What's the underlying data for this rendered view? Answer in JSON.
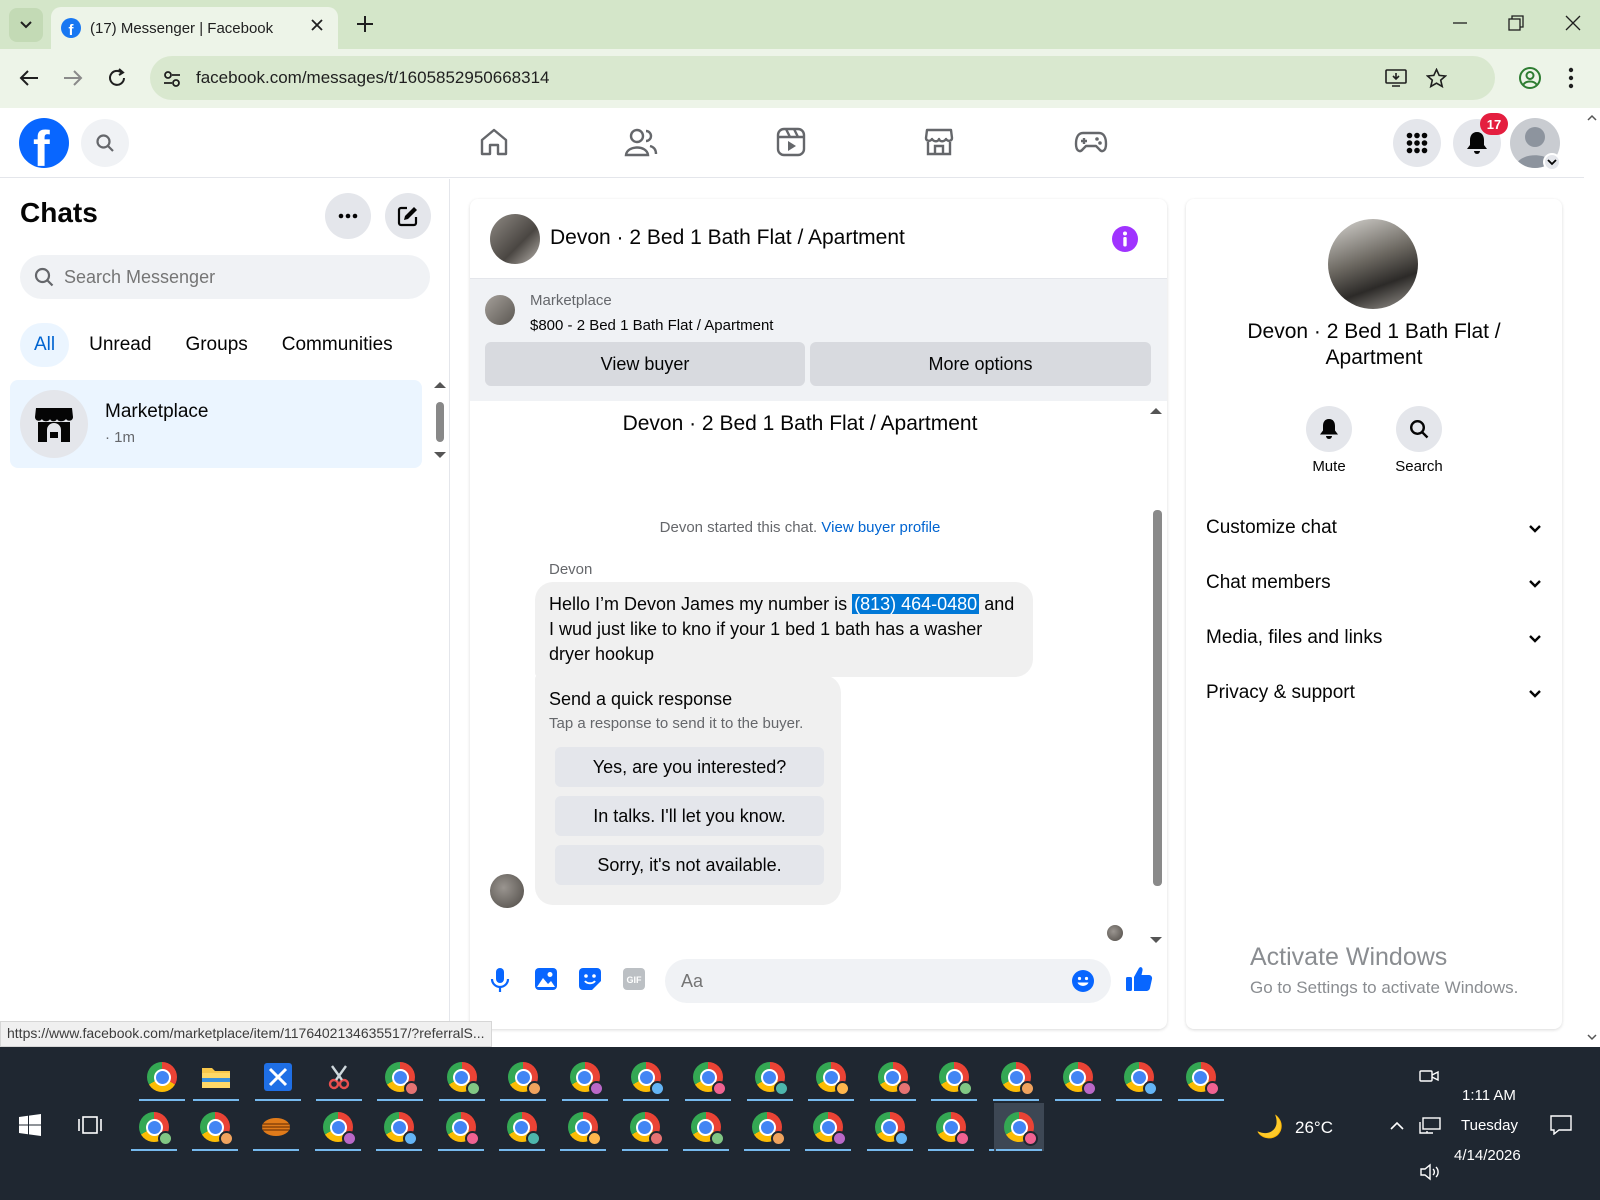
{
  "browser": {
    "tab_title": "(17) Messenger | Facebook",
    "url": "facebook.com/messages/t/1605852950668314"
  },
  "facebook": {
    "notification_count": "17"
  },
  "sidebar": {
    "title": "Chats",
    "search_placeholder": "Search Messenger",
    "filters": [
      "All",
      "Unread",
      "Groups",
      "Communities"
    ],
    "active_filter": "All",
    "chats": [
      {
        "name": "Marketplace",
        "time": "· 1m"
      }
    ]
  },
  "conversation": {
    "title": "Devon · 2 Bed 1 Bath Flat / Apartment",
    "banner": {
      "label": "Marketplace",
      "listing": "$800 - 2 Bed 1 Bath Flat / Apartment",
      "view_buyer": "View buyer",
      "more_options": "More options"
    },
    "started_text": "Devon started this chat.",
    "view_buyer_profile": "View buyer profile",
    "sender": "Devon",
    "message_before": "Hello I’m Devon James my number is ",
    "message_highlight": "(813) 464-0480",
    "message_after": " and I wud just like to kno if your 1 bed 1 bath has a washer dryer hookup",
    "quick_response": {
      "title": "Send a quick response",
      "subtitle": "Tap a response to send it to the buyer.",
      "options": [
        "Yes, are you interested?",
        "In talks. I'll let you know.",
        "Sorry, it's not available."
      ]
    },
    "input_placeholder": "Aa"
  },
  "details": {
    "name": "Devon · 2 Bed 1 Bath Flat / Apartment",
    "actions": [
      "Mute",
      "Search"
    ],
    "sections": [
      "Customize chat",
      "Chat members",
      "Media, files and links",
      "Privacy & support"
    ],
    "watermark_title": "Activate Windows",
    "watermark_sub": "Go to Settings to activate Windows."
  },
  "status_url": "https://www.facebook.com/marketplace/item/1176402134635517/?referralS...",
  "taskbar": {
    "weather": "26°C",
    "time": "1:11 AM",
    "day": "Tuesday",
    "date": "4/14/2026"
  },
  "colors": {
    "fb_blue": "#0866ff",
    "selection": "#0078d7",
    "accent_purple": "#a033ff",
    "badge_red": "#e41e3f",
    "chrome_frame": "#d4e6c9"
  }
}
